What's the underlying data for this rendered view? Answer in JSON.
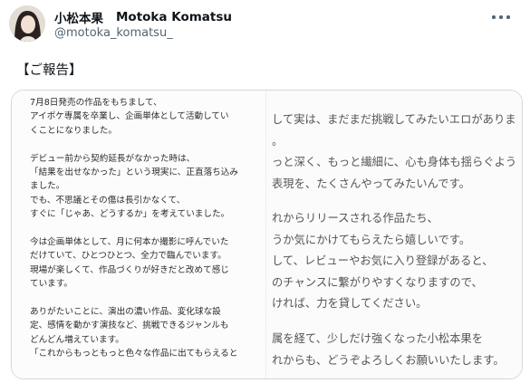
{
  "author": {
    "name": "小松本果",
    "name_en": "Motoka Komatsu",
    "handle": "@motoka_komatsu_",
    "avatar_icon": "profile-photo"
  },
  "header": {
    "more_icon": "more-horizontal-icon"
  },
  "post": {
    "text": "【ご報告】"
  },
  "image_left_lines": [
    "7月8日発売の作品をもちまして、",
    "アイポケ専属を卒業し、企画単体として活動してい",
    "くことになりました。",
    "",
    "デビュー前から契約延長がなかった時は、",
    "「結果を出せなかった」という現実に、正直落ち込み",
    "ました。",
    "でも、不思議とその傷は長引かなくて、",
    "すぐに「じゃあ、どうするか」を考えていました。",
    "",
    "今は企画単体として、月に何本か撮影に呼んでいた",
    "だけていて、ひとつひとつ、全力で臨んでいます。",
    "現場が楽しくて、作品づくりが好きだと改めて感じ",
    "ています。",
    "",
    "ありがたいことに、演出の濃い作品、変化球な設",
    "定、感情を動かす演技など、挑戦できるジャンルも",
    "どんどん増えています。",
    "「これからもっともっと色々な作品に出てもらえると"
  ],
  "image_right_lines": [
    "して実は、まだまだ挑戦してみたいエロがありま",
    "。",
    "っと深く、もっと繊細に、心も身体も揺らぐよう",
    "表現を、たくさんやってみたいんです。",
    "",
    "れからリリースされる作品たち、",
    "うか気にかけてもらえたら嬉しいです。",
    "して、レビューやお気に入り登録があると、",
    "のチャンスに繋がりやすくなりますので、",
    "ければ、力を貸してください。",
    "",
    "属を経て、少しだけ強くなった小松本果を",
    "れからも、どうぞよろしくお願いいたします。"
  ]
}
